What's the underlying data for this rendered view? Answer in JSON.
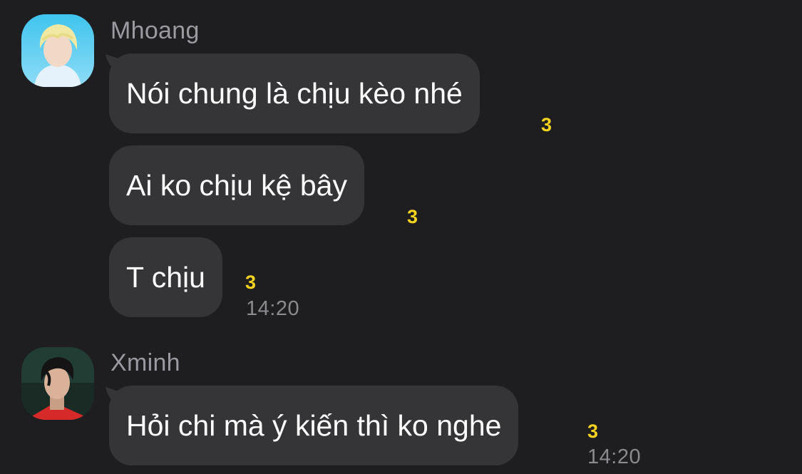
{
  "groups": [
    {
      "sender": "Mhoang",
      "avatar": "avatar-mhoang",
      "messages": [
        {
          "text": "Nói chung là chịu kèo nhé",
          "reaction_count": "3"
        },
        {
          "text": "Ai ko chịu kệ bây",
          "reaction_count": "3"
        },
        {
          "text": "T chịu",
          "reaction_count": "3"
        }
      ],
      "time": "14:20"
    },
    {
      "sender": "Xminh",
      "avatar": "avatar-xminh",
      "messages": [
        {
          "text": "Hỏi chi mà ý kiến thì ko nghe",
          "reaction_count": "3"
        }
      ],
      "time": "14:20"
    }
  ],
  "colors": {
    "background": "#1e1e20",
    "bubble": "#353538",
    "sender_name": "#9a9aa0",
    "reaction_count": "#f5d31f",
    "timestamp": "#8a8a8f"
  }
}
